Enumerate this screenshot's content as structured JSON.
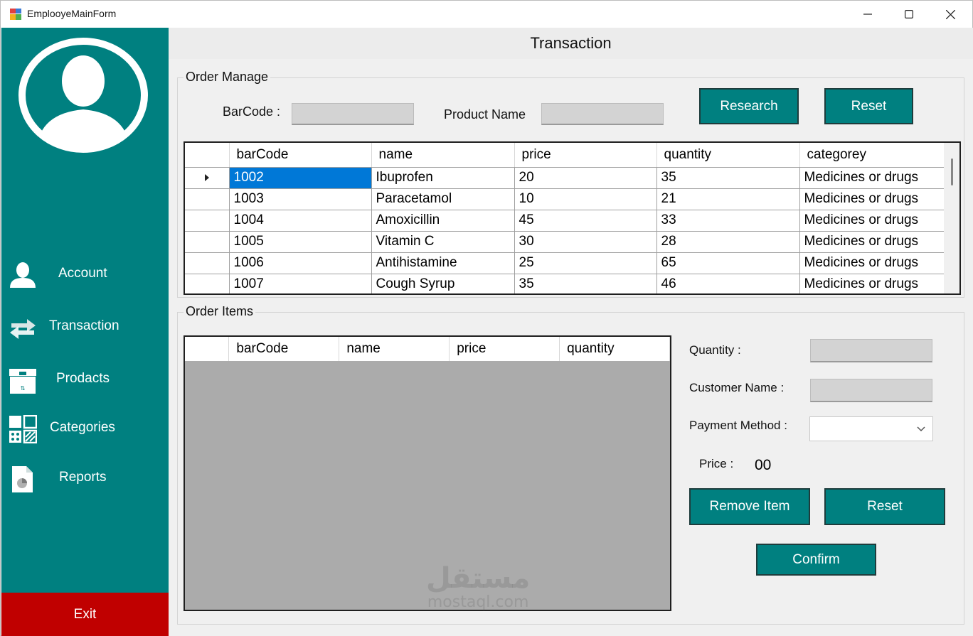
{
  "window": {
    "title": "EmplooyeMainForm"
  },
  "sidebar": {
    "items": [
      {
        "label": "Account",
        "icon": "user-icon"
      },
      {
        "label": "Transaction",
        "icon": "swap-arrows-icon"
      },
      {
        "label": "Prodacts",
        "icon": "box-icon"
      },
      {
        "label": "Categories",
        "icon": "grid-icon"
      },
      {
        "label": "Reports",
        "icon": "report-icon"
      }
    ],
    "exit_label": "Exit"
  },
  "header": {
    "title": "Transaction"
  },
  "order_manage": {
    "legend": "Order Manage",
    "barcode_label": "BarCode :",
    "product_name_label": "Product Name",
    "research_label": "Research",
    "reset_label": "Reset",
    "columns": [
      "barCode",
      "name",
      "price",
      "quantity",
      "categorey"
    ],
    "rows": [
      {
        "barCode": "1002",
        "name": "Ibuprofen",
        "price": "20",
        "quantity": "35",
        "categorey": "Medicines or drugs"
      },
      {
        "barCode": "1003",
        "name": "Paracetamol",
        "price": "10",
        "quantity": "21",
        "categorey": "Medicines or drugs"
      },
      {
        "barCode": "1004",
        "name": "Amoxicillin",
        "price": "45",
        "quantity": "33",
        "categorey": "Medicines or drugs"
      },
      {
        "barCode": "1005",
        "name": "Vitamin C",
        "price": "30",
        "quantity": "28",
        "categorey": "Medicines or drugs"
      },
      {
        "barCode": "1006",
        "name": "Antihistamine",
        "price": "25",
        "quantity": "65",
        "categorey": "Medicines or drugs"
      },
      {
        "barCode": "1007",
        "name": "Cough Syrup",
        "price": "35",
        "quantity": "46",
        "categorey": "Medicines or drugs"
      }
    ]
  },
  "order_items": {
    "legend": "Order Items",
    "columns": [
      "barCode",
      "name",
      "price",
      "quantity"
    ],
    "quantity_label": "Quantity :",
    "customer_name_label": "Customer Name :",
    "payment_method_label": "Payment Method :",
    "price_label": "Price :",
    "price_value": "00",
    "remove_item_label": "Remove Item",
    "reset_label": "Reset",
    "confirm_label": "Confirm"
  },
  "watermark": {
    "line1": "مستقل",
    "line2": "mostaql.com"
  },
  "colors": {
    "teal": "#008080",
    "exit_red": "#c00000",
    "selection": "#0078d7",
    "grid_empty": "#ababab"
  }
}
